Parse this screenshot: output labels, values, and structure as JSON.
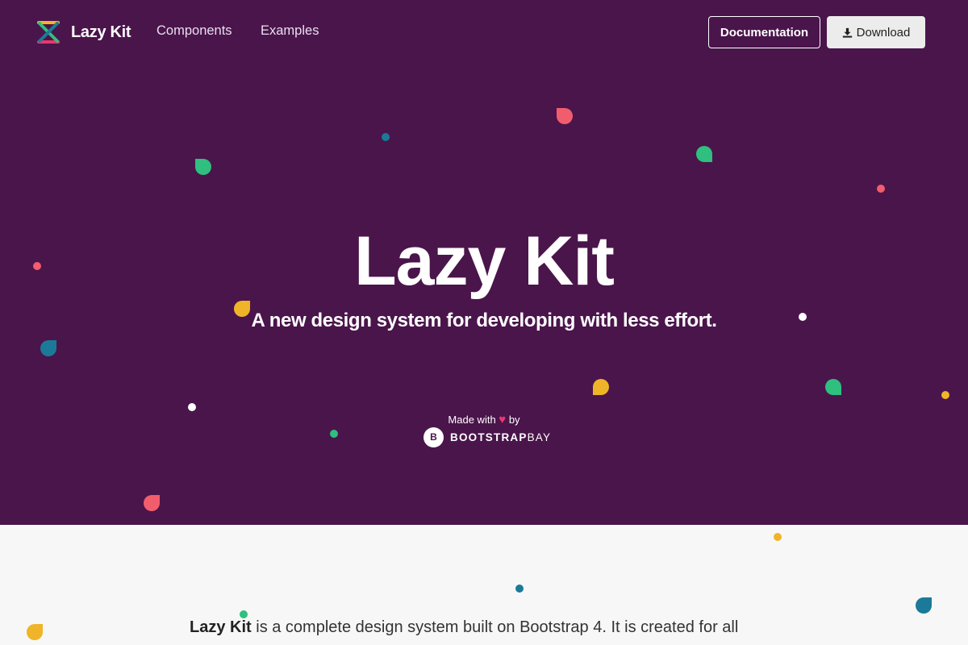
{
  "nav": {
    "brand": "Lazy Kit",
    "links": [
      "Components",
      "Examples"
    ],
    "documentation": "Documentation",
    "download": "Download"
  },
  "hero": {
    "title": "Lazy Kit",
    "subtitle": "A new design system for developing with less effort.",
    "made_with_prefix": "Made with",
    "made_with_suffix": "by",
    "heart": "♥",
    "bootstrapbay_logo": "B",
    "bootstrapbay_bold": "BOOTSTRAP",
    "bootstrapbay_light": "BAY"
  },
  "intro": {
    "bold": "Lazy Kit",
    "text": " is a complete design system built on Bootstrap 4. It is created for all"
  },
  "colors": {
    "hero_bg": "#4a154b",
    "red": "#f25d6d",
    "green": "#2fbf7f",
    "yellow": "#f0b429",
    "blue": "#1b7a97"
  },
  "icons": {
    "brand": "lazy-kit-logo-icon",
    "download": "download-icon",
    "heart": "heart-icon",
    "bootstrapbay": "bootstrapbay-logo-icon"
  }
}
